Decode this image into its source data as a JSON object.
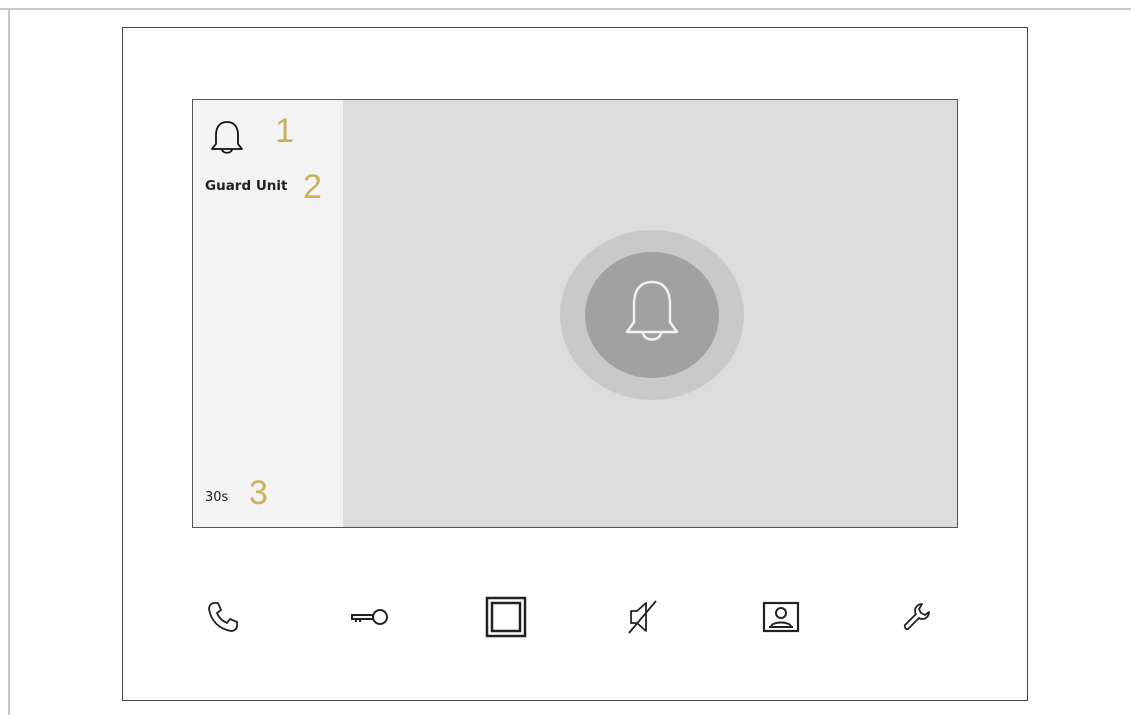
{
  "screen": {
    "caller_name": "Guard Unit",
    "timer": "30s",
    "status_icon": "bell-icon",
    "ring_icon": "bell-icon"
  },
  "callouts": [
    "1",
    "2",
    "3"
  ],
  "toolbar": [
    {
      "icon": "phone-icon"
    },
    {
      "icon": "key-icon"
    },
    {
      "icon": "surveillance-icon"
    },
    {
      "icon": "mute-icon"
    },
    {
      "icon": "user-card-icon"
    },
    {
      "icon": "wrench-icon"
    }
  ],
  "colors": {
    "callout": "#c9b25f",
    "screen_bg": "#dcdcdc",
    "side_panel_bg": "#f3f3f3",
    "ring_outer": "#c9c9c9",
    "ring_inner": "#a1a1a1"
  }
}
